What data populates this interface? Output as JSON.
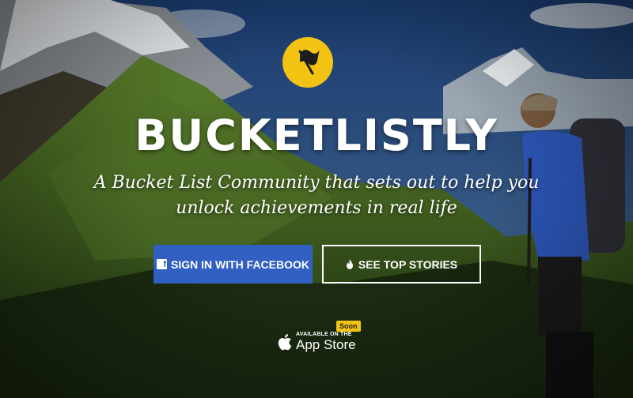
{
  "brand": {
    "name": "BUCKETLISTLY"
  },
  "hero": {
    "tagline": "A Bucket List Community that sets out to help you unlock achievements in real life",
    "background_description": "mountain-valley-hiker-photo",
    "icon": "flag-icon"
  },
  "buttons": {
    "facebook": {
      "label": "SIGN IN WITH FACEBOOK",
      "icon": "facebook-icon"
    },
    "top_stories": {
      "label": "SEE TOP STORIES",
      "icon": "fire-icon"
    }
  },
  "app_store": {
    "line1": "AVAILABLE ON THE",
    "line2": "App Store",
    "badge": "Soon",
    "icon": "apple-icon"
  },
  "colors": {
    "accent_yellow": "#f3c313",
    "facebook_blue": "#3160c2",
    "text": "#ffffff"
  }
}
